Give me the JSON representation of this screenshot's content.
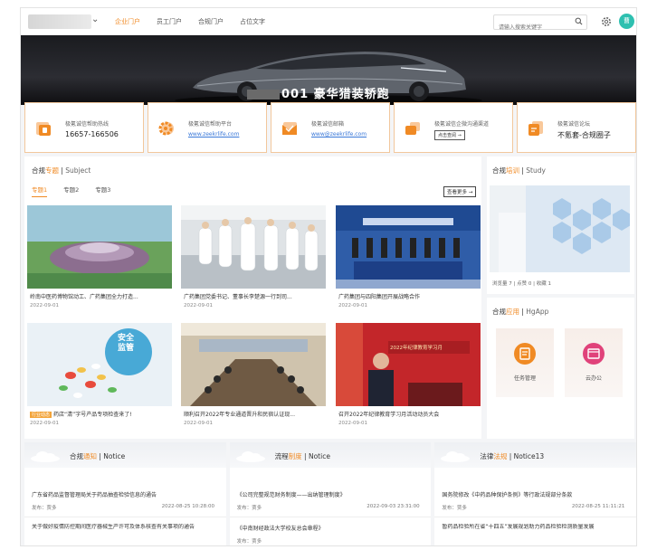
{
  "header": {
    "nav": [
      "企业门户",
      "员工门户",
      "合规门户",
      "占位文字"
    ],
    "search_placeholder": "请输入搜索关键字",
    "avatar_text": "曹"
  },
  "banner": {
    "text": "001 豪华猎装轿跑"
  },
  "services": [
    {
      "title": "极氪诚信帮助热线",
      "value": "16657-166506",
      "icon": "phone-icon",
      "color": "#f08a24"
    },
    {
      "title": "极氪诚信帮助平台",
      "link": "www.zeekrlife.com",
      "icon": "gear-icon",
      "color": "#f08a24"
    },
    {
      "title": "极氪诚信邮箱",
      "link": "www@zeekrlife.com",
      "icon": "mail-icon",
      "color": "#f08a24"
    },
    {
      "title": "极氪诚信企微沟通渠道",
      "button": "点击查阅 →",
      "icon": "chat-icon",
      "color": "#f08a24"
    },
    {
      "title": "极氪诚信论坛",
      "value": "不氪套-合规圈子",
      "icon": "forum-icon",
      "color": "#f08a24"
    }
  ],
  "news": {
    "head_prefix": "合规",
    "head_highlight": "专题",
    "head_en": "Subject",
    "tabs": [
      "专题1",
      "专题2",
      "专题3"
    ],
    "more": "查看更多 →",
    "items": [
      {
        "title": "岭南中医药博物馆动工、广药集团全力打造...",
        "date": "2022-09-01"
      },
      {
        "title": "广药集团党委书记、董事长李楚源一行到司...",
        "date": "2022-09-01"
      },
      {
        "title": "广药集团与四阳集团开展战略合作",
        "date": "2022-09-01"
      },
      {
        "tag": "行业动态",
        "title": "药店“清”字号产品专项检查来了!",
        "date": "2022-09-01",
        "overlay": "安全\n监管"
      },
      {
        "title": "顺利召开2022年专业通道晋升和民宿认证现...",
        "date": "2022-09-01"
      },
      {
        "title": "召开2022年纪律教育学习月活动动员大会",
        "date": "2022-09-01",
        "overlay": "2022年纪律教育学习月"
      }
    ]
  },
  "study": {
    "head_prefix": "合规",
    "head_highlight": "培训",
    "head_en": "Study",
    "meta": [
      "浏览量 7",
      "点赞 0",
      "收藏 1"
    ]
  },
  "apps": {
    "head_prefix": "合规",
    "head_highlight": "应用",
    "head_en": "HgApp",
    "items": [
      {
        "label": "任务管理",
        "color": "#f08a24"
      },
      {
        "label": "云办公",
        "color": "#e0427a"
      }
    ]
  },
  "notices": [
    {
      "head_prefix": "合规",
      "head_highlight": "通知",
      "head_en": "Notice",
      "items": [
        {
          "title": "广东省药品监督管理局关于药品抽查检验信息的通告",
          "author": "发布：贾多",
          "date": "2022-08-25 10:28:00"
        },
        {
          "title": "关于做好疫情防控期间医疗器械生产许可及体系核查有关事项的通告",
          "author": "",
          "date": ""
        }
      ]
    },
    {
      "head_prefix": "流程",
      "head_highlight": "制度",
      "head_en": "Notice",
      "items": [
        {
          "title": "《公司完整规范财务制度——出纳管理制度》",
          "author": "发布：贾多",
          "date": "2022-09-03 23:31:00"
        },
        {
          "title": "《中南财经政法大学校友总会章程》",
          "author": "发布：贾多",
          "date": ""
        }
      ]
    },
    {
      "head_prefix": "法律",
      "head_highlight": "法规",
      "head_en": "Notice13",
      "items": [
        {
          "title": "国务院修改《中药品种保护条例》等行政法规部分条款",
          "author": "发布：贾多",
          "date": "2022-08-25 11:11:21"
        },
        {
          "title": "暂药品检验所在省“十四五”发展规划助力药品检验检测质量发展",
          "author": "",
          "date": ""
        }
      ]
    }
  ]
}
